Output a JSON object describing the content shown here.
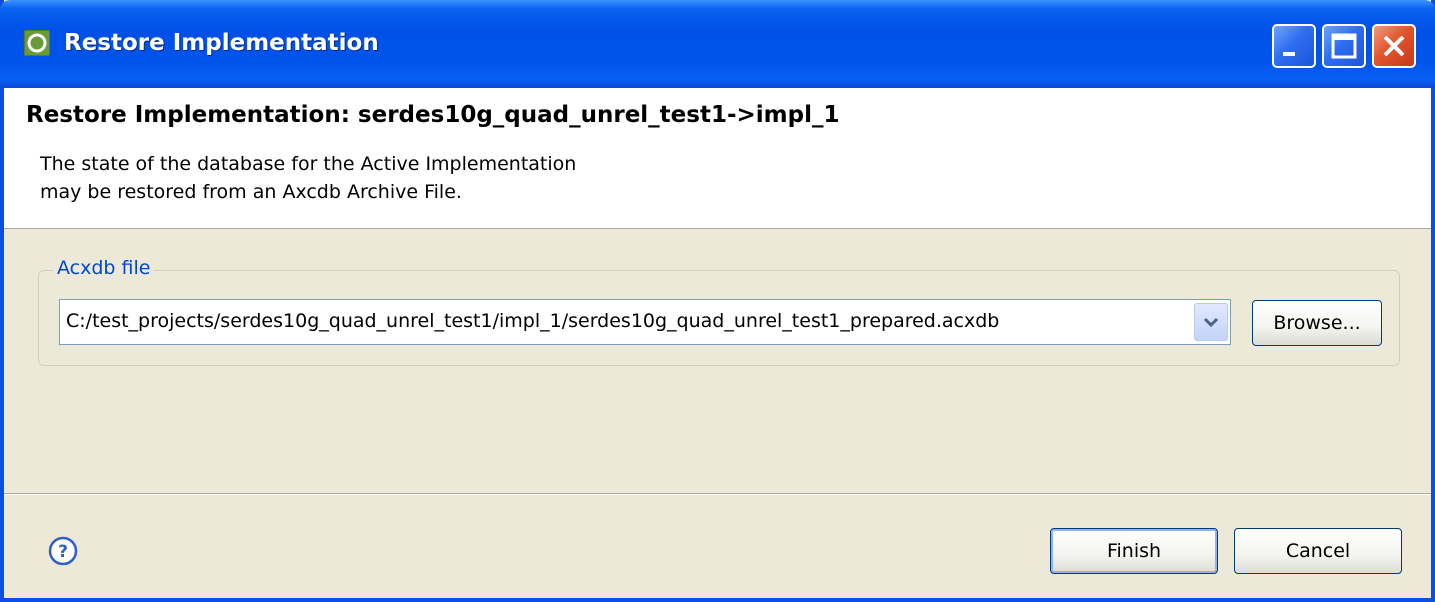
{
  "window": {
    "title": "Restore Implementation"
  },
  "header": {
    "title": "Restore Implementation: serdes10g_quad_unrel_test1->impl_1",
    "description_line1": "The state of the database for the Active Implementation",
    "description_line2": "may be restored from an Axcdb Archive File."
  },
  "file_group": {
    "legend": "Acxdb file",
    "selected_value": "C:/test_projects/serdes10g_quad_unrel_test1/impl_1/serdes10g_quad_unrel_test1_prepared.acxdb",
    "browse_label": "Browse..."
  },
  "footer": {
    "finish_label": "Finish",
    "cancel_label": "Cancel"
  },
  "icons": {
    "app": "eclipse-icon",
    "help": "help-icon",
    "minimize": "minimize-icon",
    "maximize": "maximize-icon",
    "close": "close-icon",
    "dropdown": "chevron-down-icon"
  },
  "colors": {
    "titlebar": "#0054eb",
    "dialog_bg": "#ece9d8",
    "legend_text": "#0046d5",
    "close_button": "#e2552d"
  }
}
